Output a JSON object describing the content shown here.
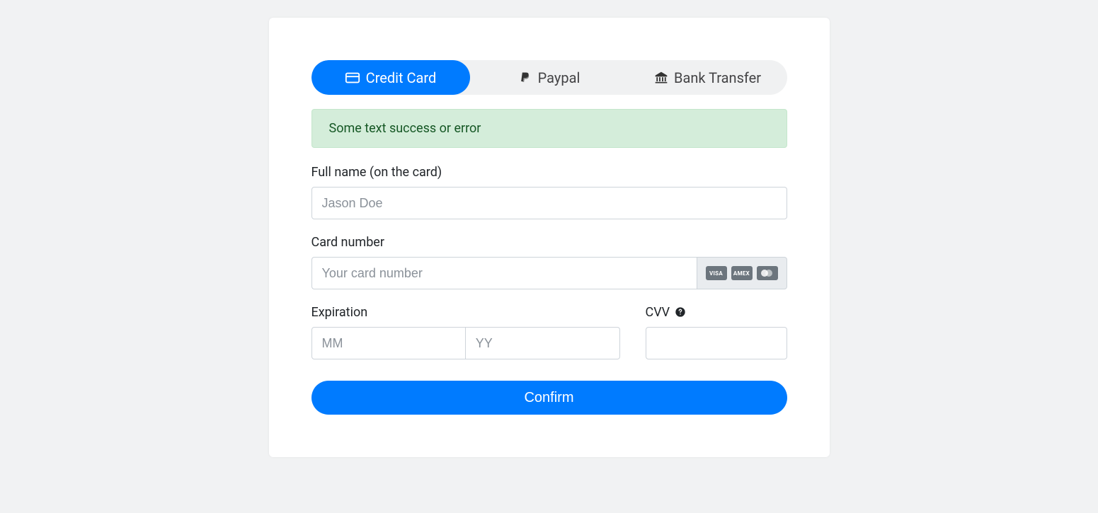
{
  "tabs": {
    "credit_card": "Credit Card",
    "paypal": "Paypal",
    "bank_transfer": "Bank Transfer"
  },
  "alert": {
    "message": "Some text success or error"
  },
  "form": {
    "full_name_label": "Full name (on the card)",
    "full_name_placeholder": "Jason Doe",
    "card_number_label": "Card number",
    "card_number_placeholder": "Your card number",
    "expiration_label": "Expiration",
    "expiration_mm_placeholder": "MM",
    "expiration_yy_placeholder": "YY",
    "cvv_label": "CVV",
    "confirm_label": "Confirm"
  },
  "card_brands": {
    "visa": "VISA",
    "amex": "AMEX"
  }
}
